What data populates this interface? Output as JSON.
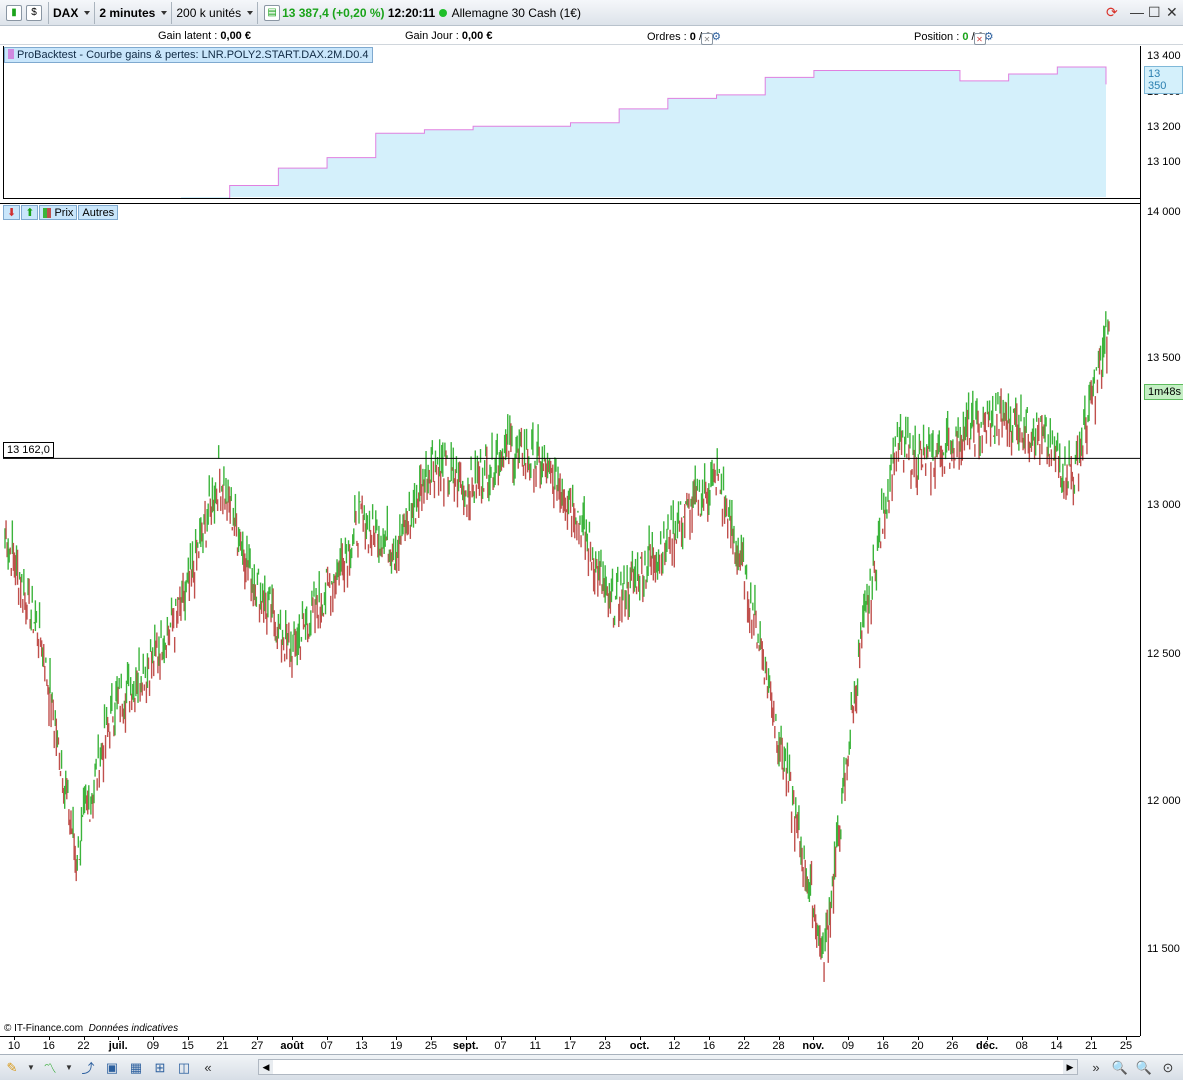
{
  "toolbar": {
    "instrument": "DAX",
    "timeframe": "2 minutes",
    "units": "200 k unités",
    "last_price": "13 387,4",
    "change": "(+0,20 %)",
    "time": "12:20:11",
    "market_name": "Allemagne 30 Cash (1€)"
  },
  "infobar": {
    "gain_latent_label": "Gain latent :",
    "gain_latent_value": "0,00 €",
    "gain_jour_label": "Gain Jour :",
    "gain_jour_value": "0,00 €",
    "ordres_label": "Ordres :",
    "ordres_value1": "0",
    "ordres_sep": "/",
    "ordres_value2": "0",
    "position_label": "Position :",
    "position_value": "0",
    "position_sep": "/",
    "position_value2": "0"
  },
  "backtest_panel": {
    "title": "ProBacktest - Courbe gains & pertes: LNR.POLY2.START.DAX.2M.D0.4",
    "y_labels": [
      "13 400",
      "13 300",
      "13 200",
      "13 100"
    ],
    "current_value": "13 350"
  },
  "price_panel": {
    "tabs": [
      "Prix",
      "Autres"
    ],
    "y_labels": [
      "14 000",
      "13 500",
      "13 000",
      "12 500",
      "12 000",
      "11 500"
    ],
    "hline_value": "13 162,0",
    "countdown": "1m48s"
  },
  "xaxis": {
    "labels": [
      {
        "t": "10",
        "b": false
      },
      {
        "t": "16",
        "b": false
      },
      {
        "t": "22",
        "b": false
      },
      {
        "t": "juil.",
        "b": true
      },
      {
        "t": "09",
        "b": false
      },
      {
        "t": "15",
        "b": false
      },
      {
        "t": "21",
        "b": false
      },
      {
        "t": "27",
        "b": false
      },
      {
        "t": "août",
        "b": true
      },
      {
        "t": "07",
        "b": false
      },
      {
        "t": "13",
        "b": false
      },
      {
        "t": "19",
        "b": false
      },
      {
        "t": "25",
        "b": false
      },
      {
        "t": "sept.",
        "b": true
      },
      {
        "t": "07",
        "b": false
      },
      {
        "t": "11",
        "b": false
      },
      {
        "t": "17",
        "b": false
      },
      {
        "t": "23",
        "b": false
      },
      {
        "t": "oct.",
        "b": true
      },
      {
        "t": "12",
        "b": false
      },
      {
        "t": "16",
        "b": false
      },
      {
        "t": "22",
        "b": false
      },
      {
        "t": "28",
        "b": false
      },
      {
        "t": "nov.",
        "b": true
      },
      {
        "t": "09",
        "b": false
      },
      {
        "t": "16",
        "b": false
      },
      {
        "t": "20",
        "b": false
      },
      {
        "t": "26",
        "b": false
      },
      {
        "t": "déc.",
        "b": true
      },
      {
        "t": "08",
        "b": false
      },
      {
        "t": "14",
        "b": false
      },
      {
        "t": "21",
        "b": false
      },
      {
        "t": "25",
        "b": false
      }
    ]
  },
  "footer": {
    "copyright": "© IT-Finance.com",
    "note": "Données indicatives"
  },
  "chart_data": {
    "type": "line",
    "x": [
      "10",
      "16",
      "22",
      "juil.",
      "09",
      "15",
      "21",
      "27",
      "août",
      "07",
      "13",
      "19",
      "25",
      "sept.",
      "07",
      "11",
      "17",
      "23",
      "oct.",
      "12",
      "16",
      "22",
      "28",
      "nov.",
      "09",
      "16",
      "20",
      "26",
      "déc.",
      "08",
      "14",
      "21"
    ],
    "series": [
      {
        "values": [
          12900,
          12550,
          11800,
          12300,
          12450,
          12650,
          13100,
          12750,
          12500,
          12700,
          12950,
          12850,
          13150,
          13050,
          13200,
          13150,
          13000,
          12650,
          12800,
          12950,
          13100,
          12650,
          12050,
          11450,
          12500,
          13200,
          13150,
          13250,
          13300,
          13250,
          13100,
          13600
        ]
      }
    ],
    "ylim": [
      11300,
      14050
    ],
    "equity": [
      12990,
      13060,
      13110,
      13140,
      13210,
      13220,
      13230,
      13230,
      13240,
      13280,
      13310,
      13320,
      13370,
      13390,
      13390,
      13390,
      13360,
      13380,
      13400,
      13350
    ]
  },
  "colors": {
    "up": "#3cb43c",
    "down": "#c0504d",
    "equity_fill": "#d4f0fb",
    "equity_line": "#e080e0"
  }
}
